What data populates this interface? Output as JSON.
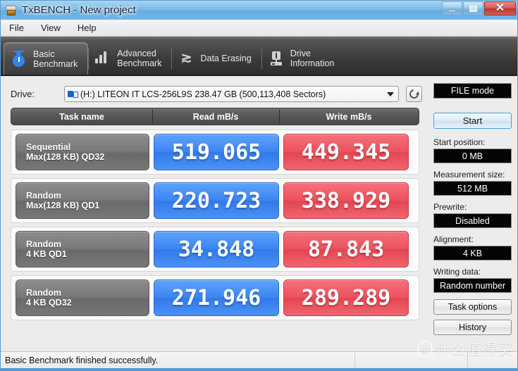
{
  "window": {
    "title": "TxBENCH - New project",
    "icon": "drive-icon",
    "minimize_label": "",
    "maximize_label": "",
    "close_label": "✕"
  },
  "menu": {
    "items": [
      {
        "label": "File"
      },
      {
        "label": "View"
      },
      {
        "label": "Help"
      }
    ]
  },
  "tabs": [
    {
      "label": "Basic\nBenchmark",
      "icon": "stopwatch-icon",
      "active": true
    },
    {
      "label": "Advanced\nBenchmark",
      "icon": "bar-chart-icon",
      "active": false
    },
    {
      "label": "Data Erasing",
      "icon": "zigzag-erase-icon",
      "active": false
    },
    {
      "label": "Drive\nInformation",
      "icon": "drive-info-icon",
      "active": false
    }
  ],
  "drive": {
    "label": "Drive:",
    "value": "(H:) LITEON IT LCS-256L9S  238.47 GB (500,113,408 Sectors)",
    "icon": "drive-volume-icon",
    "refresh_icon": "refresh-icon"
  },
  "table": {
    "headers": {
      "task": "Task name",
      "read": "Read mB/s",
      "write": "Write mB/s"
    },
    "rows": [
      {
        "task_line1": "Sequential",
        "task_line2": "Max(128 KB) QD32",
        "read": "519.065",
        "write": "449.345"
      },
      {
        "task_line1": "Random",
        "task_line2": "Max(128 KB) QD1",
        "read": "220.723",
        "write": "338.929"
      },
      {
        "task_line1": "Random",
        "task_line2": "4 KB QD1",
        "read": "34.848",
        "write": "87.843"
      },
      {
        "task_line1": "Random",
        "task_line2": "4 KB QD32",
        "read": "271.946",
        "write": "289.289"
      }
    ]
  },
  "sidebar": {
    "mode": "FILE mode",
    "start_button": "Start",
    "fields": [
      {
        "label": "Start position:",
        "value": "0 MB"
      },
      {
        "label": "Measurement size:",
        "value": "512 MB"
      },
      {
        "label": "Prewrite:",
        "value": "Disabled"
      },
      {
        "label": "Alignment:",
        "value": "4 KB"
      },
      {
        "label": "Writing data:",
        "value": "Random number"
      }
    ],
    "task_options_button": "Task options",
    "history_button": "History"
  },
  "statusbar": {
    "message": "Basic Benchmark finished successfully.",
    "segment_mid": "",
    "segment_end": ""
  },
  "watermark": {
    "mark": "值",
    "text": "什么值得买"
  },
  "colors": {
    "read_accent": "#3d86f2",
    "write_accent": "#ec525e",
    "titlebar": "#63abdf",
    "tabstrip": "#3a3a3a",
    "panel_bg": "#ececec",
    "value_box_bg": "#050505"
  }
}
